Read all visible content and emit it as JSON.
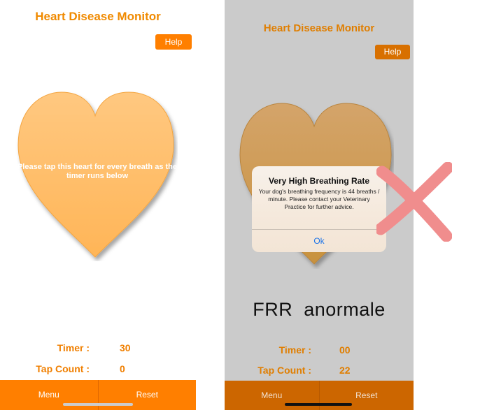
{
  "left_screen": {
    "title": "Heart Disease Monitor",
    "help_label": "Help",
    "heart_caption": "Please tap this heart for every breath as the timer runs below",
    "timer_label": "Timer :",
    "timer_value": "30",
    "tap_label": "Tap Count :",
    "tap_value": "0",
    "tabs": [
      {
        "label": "Menu"
      },
      {
        "label": "Reset"
      }
    ]
  },
  "right_screen": {
    "title": "Heart Disease Monitor",
    "help_label": "Help",
    "alert": {
      "title": "Very High Breathing Rate",
      "message": "Your dog's breathing frequency is 44 breaths / minute. Please contact your Veterinary Practice for further advice.",
      "ok_label": "Ok"
    },
    "annotation": "FRR  anormale",
    "timer_label": "Timer :",
    "timer_value": "00",
    "tap_label": "Tap Count :",
    "tap_value": "22",
    "tabs": [
      {
        "label": "Menu"
      },
      {
        "label": "Reset"
      }
    ]
  },
  "colors": {
    "brand_orange": "#ff7f00",
    "title_orange": "#f08a00",
    "overlay_gray": "#cbcbcb",
    "cross_pink": "#f08d8d",
    "link_blue": "#1a73e8"
  },
  "icons": {
    "heart": "heart-icon",
    "cross": "cross-icon"
  }
}
